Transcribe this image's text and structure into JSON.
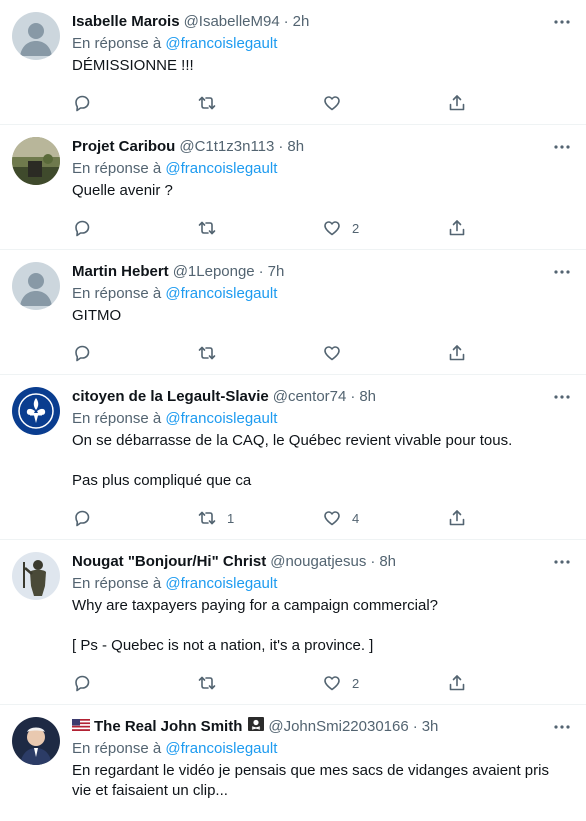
{
  "reply_prefix": "En réponse à",
  "tweets": [
    {
      "name": "Isabelle Marois",
      "handle": "@IsabelleM94",
      "time": "2h",
      "reply_to": "@francoislegault",
      "text": "DÉMISSIONNE !!!",
      "retweets": "",
      "likes": "",
      "avatar": "default-avatar"
    },
    {
      "name": "Projet Caribou",
      "handle": "@C1t1z3n113",
      "time": "8h",
      "reply_to": "@francoislegault",
      "text": "Quelle avenir ?",
      "retweets": "",
      "likes": "2",
      "avatar": "photo-landscape-avatar"
    },
    {
      "name": "Martin Hebert",
      "handle": "@1Leponge",
      "time": "7h",
      "reply_to": "@francoislegault",
      "text": "GITMO",
      "retweets": "",
      "likes": "",
      "avatar": "default-avatar"
    },
    {
      "name": "citoyen de la Legault-Slavie",
      "handle": "@centor74",
      "time": "8h",
      "reply_to": "@francoislegault",
      "text": "On se débarrasse de la CAQ, le Québec revient vivable pour tous.\n\nPas plus compliqué que ca",
      "retweets": "1",
      "likes": "4",
      "avatar": "fleur-de-lis-avatar"
    },
    {
      "name": "Nougat \"Bonjour/Hi\" Christ",
      "handle": "@nougatjesus",
      "time": "8h",
      "reply_to": "@francoislegault",
      "text": "Why are taxpayers paying for a campaign commercial?\n\n[ Ps - Quebec is not a nation, it's a province. ]",
      "retweets": "",
      "likes": "2",
      "avatar": "statue-avatar"
    },
    {
      "name": "The Real John Smith",
      "handle": "@JohnSmi22030166",
      "time": "3h",
      "reply_to": "@francoislegault",
      "text": "En regardant le vidéo je pensais que mes sacs de vidanges avaient pris vie et faisaient un clip...\n\nBen non cétait juste toi",
      "retweets": "",
      "likes": "",
      "avatar": "portrait-avatar",
      "name_prefix_icon": "us-flag-icon",
      "name_suffix_icon": "pirate-flag-icon"
    }
  ],
  "colors": {
    "link": "#1d9bf0",
    "secondary_text": "#536471",
    "primary_text": "#0f1419",
    "divider": "#eff3f4"
  }
}
